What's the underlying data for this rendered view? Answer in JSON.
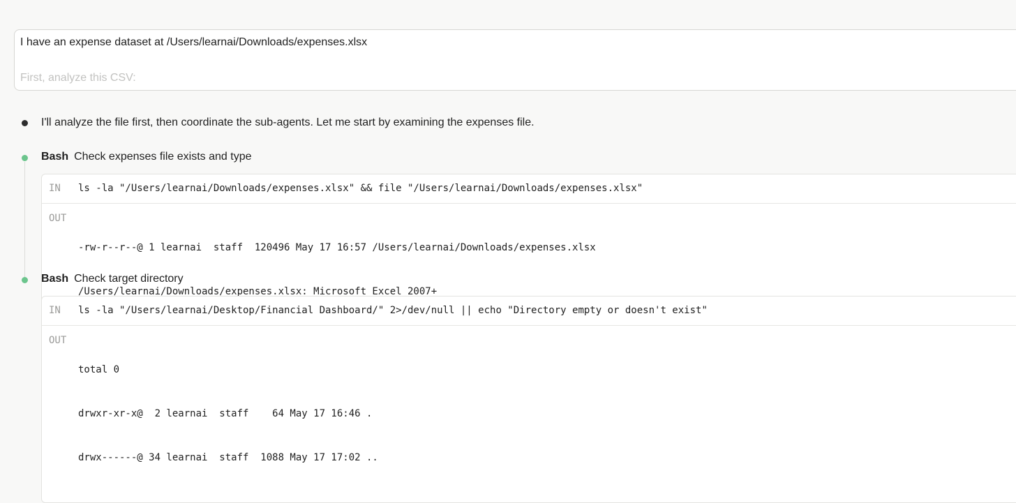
{
  "prompt": {
    "line1": "I have an expense dataset at /Users/learnai/Downloads/expenses.xlsx",
    "line2": "First, analyze this CSV:"
  },
  "assistant": {
    "message": "I'll analyze the file first, then coordinate the sub-agents. Let me start by examining the expenses file."
  },
  "tools": [
    {
      "name": "Bash",
      "description": "Check expenses file exists and type",
      "in_label": "IN",
      "out_label": "OUT",
      "input": "ls -la \"/Users/learnai/Downloads/expenses.xlsx\" && file \"/Users/learnai/Downloads/expenses.xlsx\"",
      "output": [
        "-rw-r--r--@ 1 learnai  staff  120496 May 17 16:57 /Users/learnai/Downloads/expenses.xlsx",
        "/Users/learnai/Downloads/expenses.xlsx: Microsoft Excel 2007+"
      ]
    },
    {
      "name": "Bash",
      "description": "Check target directory",
      "in_label": "IN",
      "out_label": "OUT",
      "input": "ls -la \"/Users/learnai/Desktop/Financial Dashboard/\" 2>/dev/null || echo \"Directory empty or doesn't exist\"",
      "output": [
        "total 0",
        "drwxr-xr-x@  2 learnai  staff    64 May 17 16:46 .",
        "drwx------@ 34 learnai  staff  1088 May 17 17:02 .."
      ]
    }
  ],
  "colors": {
    "background": "#f8f8f7",
    "status_done": "#6cc58d",
    "status_message": "#2d2d2d",
    "label_muted": "#9a9a98"
  }
}
